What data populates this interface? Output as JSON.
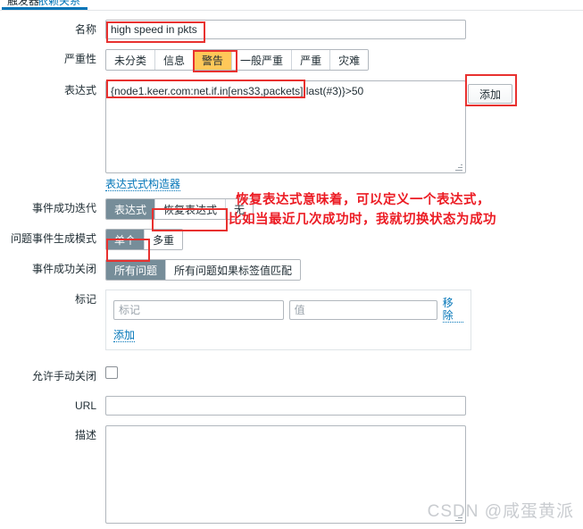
{
  "tabs": [
    {
      "label": "触发器",
      "active": true
    },
    {
      "label": "依赖关系",
      "active": false
    }
  ],
  "form": {
    "name": {
      "label": "名称",
      "value": "high speed in pkts",
      "placeholder": ""
    },
    "severity": {
      "label": "严重性",
      "options": [
        "未分类",
        "信息",
        "警告",
        "一般严重",
        "严重",
        "灾难"
      ],
      "selected": "警告"
    },
    "expression": {
      "label": "表达式",
      "value": "{node1.keer.com:net.if.in[ens33,packets].last(#3)}>50",
      "add_button": "添加",
      "constructor_link": "表达式式构造器"
    },
    "ok_event_generation": {
      "label": "事件成功迭代",
      "options": [
        "表达式",
        "恢复表达式",
        "无"
      ],
      "selected": "表达式"
    },
    "problem_event_generation_mode": {
      "label": "问题事件生成模式",
      "options": [
        "单个",
        "多重"
      ],
      "selected": "单个"
    },
    "ok_event_closes": {
      "label": "事件成功关闭",
      "options": [
        "所有问题",
        "所有问题如果标签值匹配"
      ],
      "selected": "所有问题"
    },
    "tags": {
      "label": "标记",
      "key_placeholder": "标记",
      "key_value": "",
      "value_placeholder": "值",
      "value_value": "",
      "remove_link": "移除",
      "add_link": "添加"
    },
    "allow_manual_close": {
      "label": "允许手动关闭",
      "checked": false
    },
    "url": {
      "label": "URL",
      "value": "",
      "placeholder": ""
    },
    "description": {
      "label": "描述",
      "value": "",
      "placeholder": ""
    }
  },
  "annotation": {
    "line1": "恢复表达式意味着，可以定义一个表达式，",
    "line2": "比如当最近几次成功时，我就切换状态为成功",
    "color": "#ec1c24"
  },
  "highlight_color": "#e8312f",
  "watermark": "CSDN @咸蛋黄派"
}
